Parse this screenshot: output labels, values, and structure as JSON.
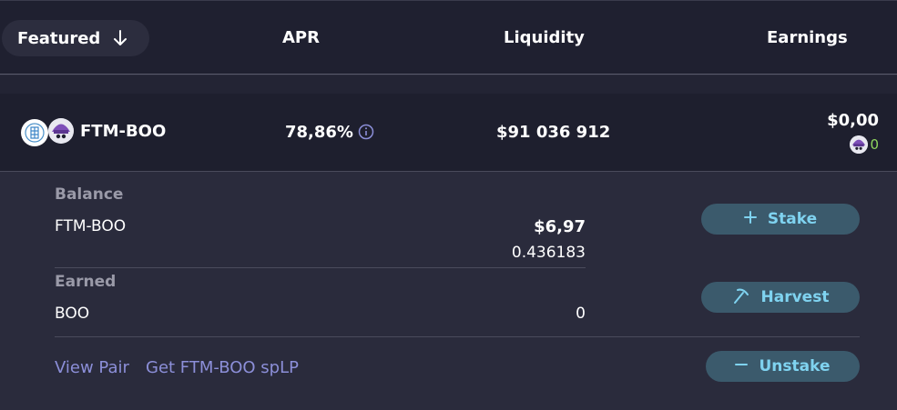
{
  "header": {
    "sort_label": "Featured",
    "apr": "APR",
    "liquidity": "Liquidity",
    "earnings": "Earnings"
  },
  "farm": {
    "pair": "FTM-BOO",
    "apr": "78,86%",
    "liquidity": "$91 036 912",
    "earnings_usd": "$0,00",
    "earnings_tokens": "0"
  },
  "details": {
    "balance_label": "Balance",
    "balance_token": "FTM-BOO",
    "balance_usd": "$6,97",
    "balance_amount": "0.436183",
    "earned_label": "Earned",
    "earned_token": "BOO",
    "earned_amount": "0"
  },
  "actions": {
    "stake": "Stake",
    "harvest": "Harvest",
    "unstake": "Unstake"
  },
  "links": {
    "view_pair": "View Pair",
    "get_lp": "Get FTM-BOO spLP"
  },
  "colors": {
    "accent": "#7fd3f0",
    "button_bg": "#3b5a6c",
    "link": "#8c8fd9",
    "positive": "#8fd65e"
  }
}
